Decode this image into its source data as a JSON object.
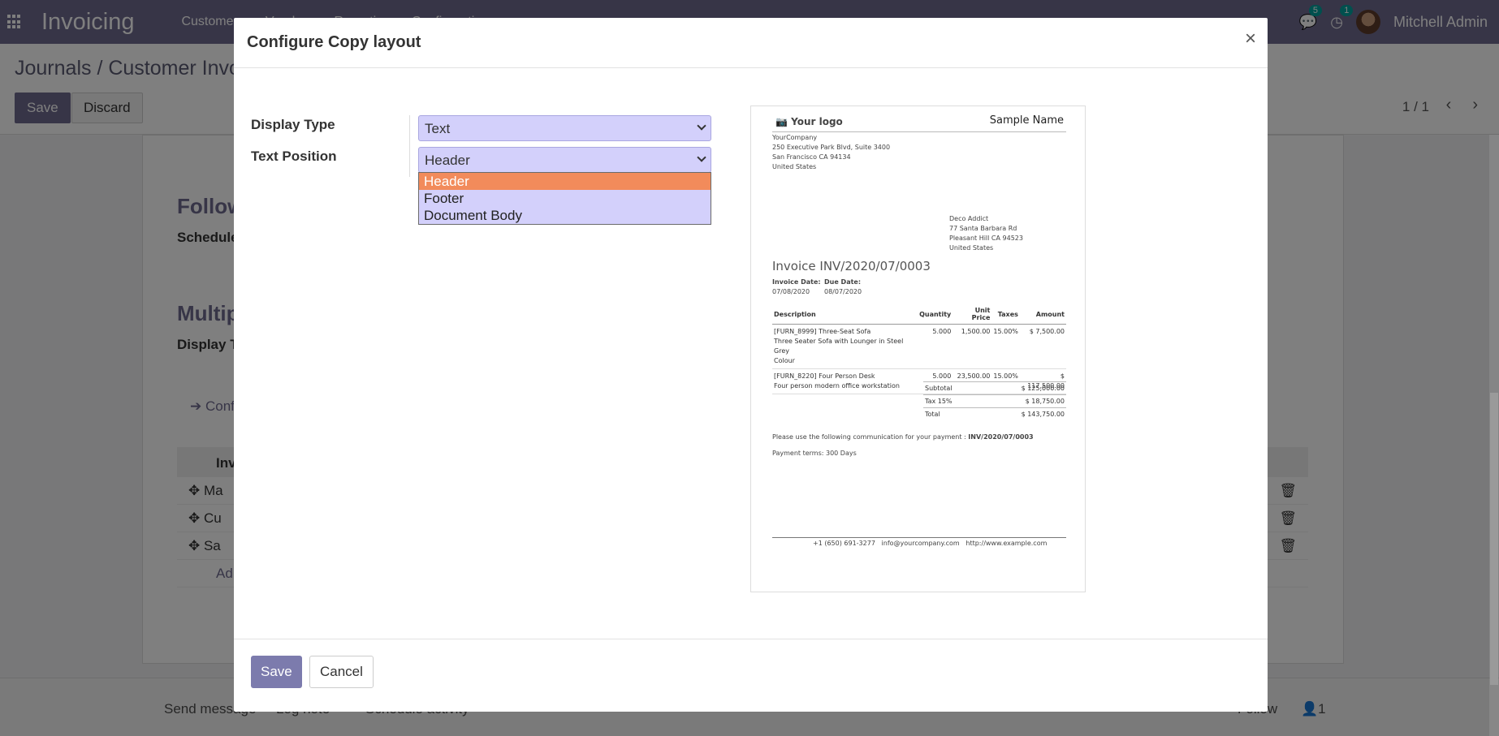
{
  "app": {
    "brand": "Invoicing",
    "menu": [
      "Customers",
      "Vendors",
      "Reporting",
      "Configuration"
    ],
    "messages_count": "5",
    "activities_count": "1",
    "user_name": "Mitchell Admin"
  },
  "control_panel": {
    "breadcrumb": "Journals / Customer Invoices",
    "save_label": "Save",
    "discard_label": "Discard",
    "pager": "1 / 1"
  },
  "sheet": {
    "heading_follow": "Follow",
    "sub_schedule": "Schedule",
    "heading_multiple": "Multip",
    "sub_display": "Display T",
    "configure_link": "Conf",
    "table_header": "Invo",
    "rows": [
      "Ma",
      "Cu",
      "Sa"
    ],
    "add_line": "Ad"
  },
  "chatter": {
    "send_message": "Send message",
    "log_note": "Log note",
    "schedule_activity": "Schedule activity",
    "follow": "Follow",
    "followers_count": "1"
  },
  "modal": {
    "title": "Configure Copy layout",
    "close_symbol": "×",
    "display_type_label": "Display Type",
    "display_type_value": "Text",
    "text_position_label": "Text Position",
    "text_position_value": "Header",
    "text_position_options": [
      "Header",
      "Footer",
      "Document Body"
    ],
    "save_label": "Save",
    "cancel_label": "Cancel"
  },
  "preview": {
    "logo_text": "Your logo",
    "sample_name": "Sample Name",
    "company_lines": [
      "YourCompany",
      "250 Executive Park Blvd, Suite 3400",
      "San Francisco CA 94134",
      "United States"
    ],
    "customer_lines": [
      "Deco Addict",
      "77 Santa Barbara Rd",
      "Pleasant Hill CA 94523",
      "United States"
    ],
    "invoice_title": "Invoice INV/2020/07/0003",
    "invoice_date_label": "Invoice Date:",
    "invoice_date": "07/08/2020",
    "due_date_label": "Due Date:",
    "due_date": "08/07/2020",
    "table_headers": [
      "Description",
      "Quantity",
      "Unit Price",
      "Taxes",
      "Amount"
    ],
    "line1": {
      "desc1": "[FURN_8999] Three-Seat Sofa",
      "desc2": "Three Seater Sofa with Lounger in Steel Grey",
      "desc3": "Colour",
      "qty": "5.000",
      "price": "1,500.00",
      "tax": "15.00%",
      "amount": "$ 7,500.00"
    },
    "line2": {
      "desc1": "[FURN_8220] Four Person Desk",
      "desc2": "Four person modern office workstation",
      "qty": "5.000",
      "price": "23,500.00",
      "tax": "15.00%",
      "amount": "$ 117,500.00"
    },
    "subtotal_label": "Subtotal",
    "subtotal": "$ 125,000.00",
    "tax_label": "Tax 15%",
    "tax": "$ 18,750.00",
    "total_label": "Total",
    "total": "$ 143,750.00",
    "payment_comm": "Please use the following communication for your payment :",
    "payment_ref": "INV/2020/07/0003",
    "payment_terms": "Payment terms: 300 Days",
    "footer_phone": "+1 (650) 691-3277",
    "footer_email": "info@yourcompany.com",
    "footer_web": "http://www.example.com"
  }
}
